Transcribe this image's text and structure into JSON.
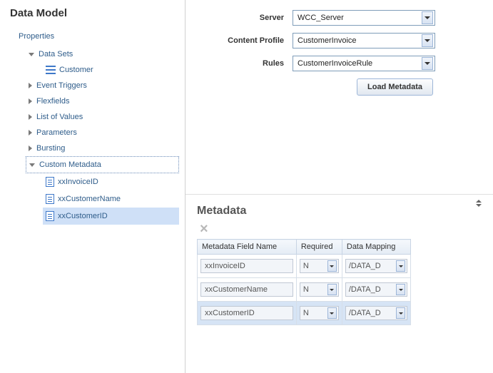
{
  "page_title": "Data Model",
  "tree": {
    "root": "Properties",
    "items": [
      {
        "label": "Data Sets",
        "expanded": true,
        "children": [
          {
            "label": "Customer",
            "icon": "node"
          }
        ]
      },
      {
        "label": "Event Triggers",
        "expanded": false
      },
      {
        "label": "Flexfields",
        "expanded": false
      },
      {
        "label": "List of Values",
        "expanded": false
      },
      {
        "label": "Parameters",
        "expanded": false
      },
      {
        "label": "Bursting",
        "expanded": false
      },
      {
        "label": "Custom Metadata",
        "expanded": true,
        "dotted": true,
        "children": [
          {
            "label": "xxInvoiceID",
            "icon": "doc"
          },
          {
            "label": "xxCustomerName",
            "icon": "doc"
          },
          {
            "label": "xxCustomerID",
            "icon": "doc",
            "selected": true
          }
        ]
      }
    ]
  },
  "form": {
    "server_label": "Server",
    "server_value": "WCC_Server",
    "profile_label": "Content Profile",
    "profile_value": "CustomerInvoice",
    "rules_label": "Rules",
    "rules_value": "CustomerInvoiceRule",
    "load_button": "Load Metadata"
  },
  "metadata": {
    "header": "Metadata",
    "columns": {
      "name": "Metadata Field Name",
      "required": "Required",
      "mapping": "Data Mapping"
    },
    "rows": [
      {
        "name": "xxInvoiceID",
        "required": "N",
        "mapping": "/DATA_D",
        "selected": false
      },
      {
        "name": "xxCustomerName",
        "required": "N",
        "mapping": "/DATA_D",
        "selected": false
      },
      {
        "name": "xxCustomerID",
        "required": "N",
        "mapping": "/DATA_D",
        "selected": true
      }
    ]
  }
}
